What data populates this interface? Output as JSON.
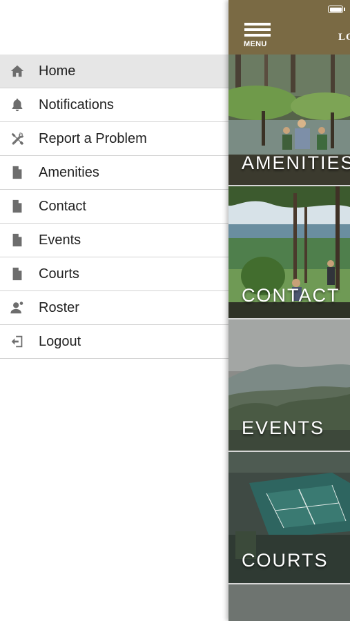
{
  "drawer": {
    "items": [
      {
        "label": "Home",
        "icon": "home-icon",
        "active": true
      },
      {
        "label": "Notifications",
        "icon": "bell-icon"
      },
      {
        "label": "Report a Problem",
        "icon": "tools-icon"
      },
      {
        "label": "Amenities",
        "icon": "document-icon"
      },
      {
        "label": "Contact",
        "icon": "document-icon"
      },
      {
        "label": "Events",
        "icon": "document-icon"
      },
      {
        "label": "Courts",
        "icon": "document-icon"
      },
      {
        "label": "Roster",
        "icon": "person-icon"
      },
      {
        "label": "Logout",
        "icon": "logout-icon"
      }
    ]
  },
  "header": {
    "menu_label": "MENU",
    "logo_text": "LO",
    "background": "#7a6a44"
  },
  "tiles": [
    {
      "label": "AMENITIES",
      "scene": "lake-shore-people"
    },
    {
      "label": "CONTACT",
      "scene": "pine-forest-gathering"
    },
    {
      "label": "EVENTS",
      "scene": "mountain-valley-mist"
    },
    {
      "label": "COURTS",
      "scene": "tennis-court-aerial"
    }
  ]
}
